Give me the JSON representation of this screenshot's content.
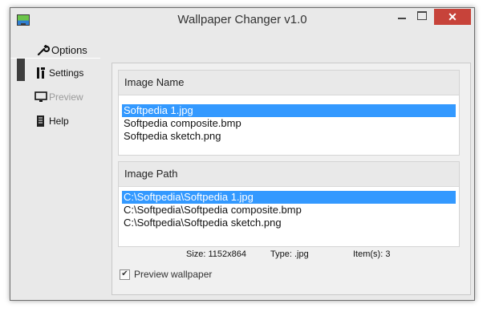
{
  "window": {
    "title": "Wallpaper Changer v1.0",
    "close_glyph": "✕"
  },
  "sidebar": {
    "items": [
      {
        "label": "Options",
        "icon": "wrench-icon"
      },
      {
        "label": "Settings",
        "icon": "tools-icon"
      },
      {
        "label": "Preview",
        "icon": "monitor-icon"
      },
      {
        "label": "Help",
        "icon": "document-icon"
      }
    ]
  },
  "image_name": {
    "header": "Image Name",
    "rows": [
      "Softpedia 1.jpg",
      "Softpedia composite.bmp",
      "Softpedia sketch.png"
    ],
    "selected_index": 0
  },
  "image_path": {
    "header": "Image Path",
    "rows": [
      "C:\\Softpedia\\Softpedia 1.jpg",
      "C:\\Softpedia\\Softpedia composite.bmp",
      "C:\\Softpedia\\Softpedia sketch.png"
    ],
    "selected_index": 0
  },
  "info": {
    "size": "Size:  1152x864",
    "type": "Type:  .jpg",
    "items": "Item(s):  3"
  },
  "preview_checkbox": {
    "label": "Preview wallpaper",
    "checked": true
  },
  "colors": {
    "selection": "#3399ff",
    "close_button": "#c7433a"
  }
}
